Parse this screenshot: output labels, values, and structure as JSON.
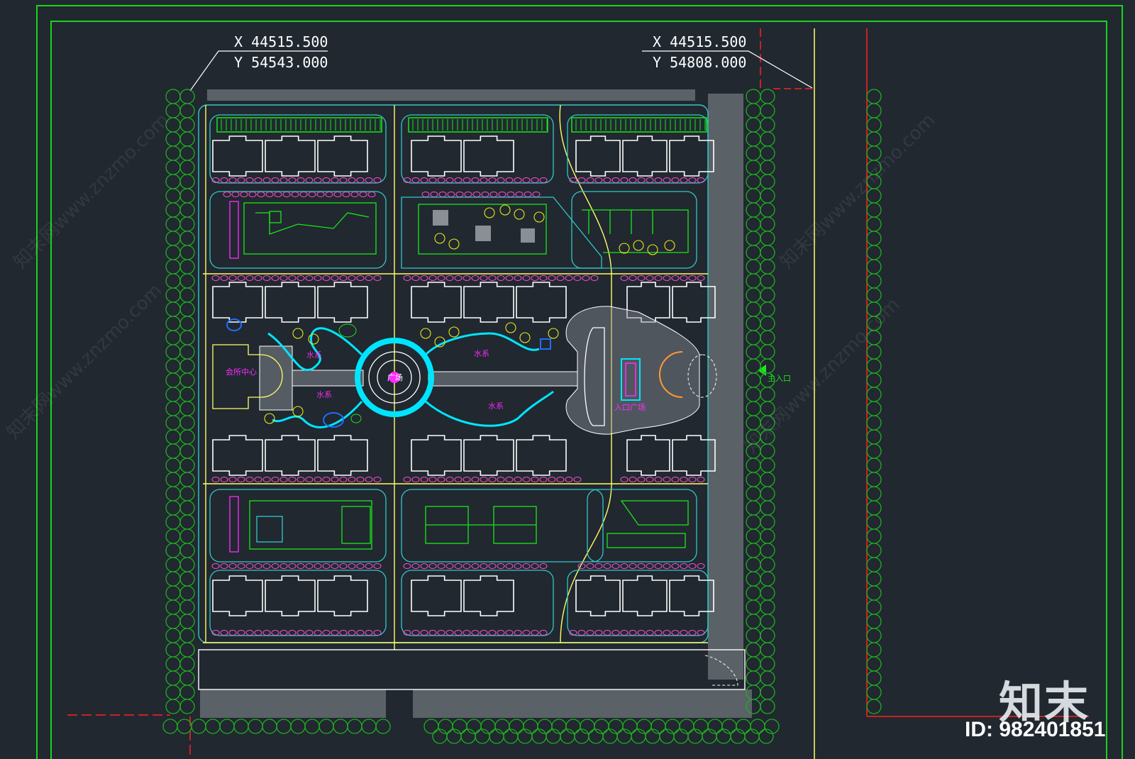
{
  "coords": {
    "left": {
      "x": "X 44515.500",
      "y": "Y 54543.000"
    },
    "right": {
      "x": "X 44515.500",
      "y": "Y 54808.000"
    }
  },
  "labels": {
    "water_1": "水系",
    "water_2": "水系",
    "water_3": "水系",
    "water_4": "水系",
    "club": "会所中心",
    "square": "入口广场",
    "entrance": "主入口",
    "center": "广场"
  },
  "watermark": {
    "site": "知末网www.znzmo.com",
    "logo": "知末",
    "id": "ID: 982401851"
  },
  "colors": {
    "background": "#212830",
    "border": "#19d419",
    "building": "#ffffff",
    "road": "#ffff66",
    "water": "#00e5ff",
    "cad_cyan": "#30c8c8",
    "tree": "#1eb11e",
    "label": "#ff2bff",
    "boundary": "#ff2020"
  }
}
